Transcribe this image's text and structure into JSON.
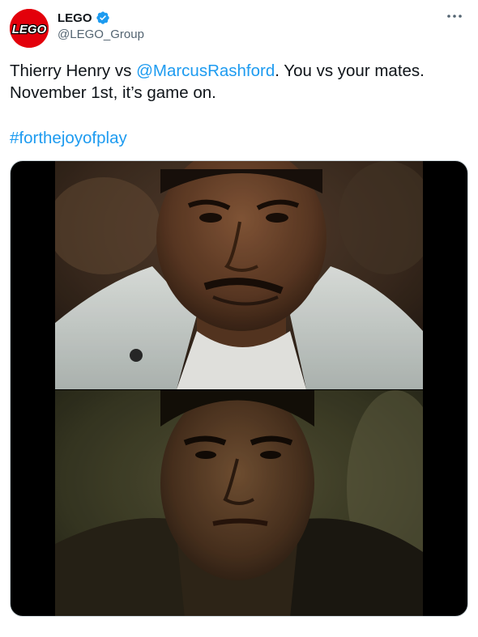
{
  "author": {
    "display_name": "LEGO",
    "handle": "@LEGO_Group",
    "avatar_text": "LEGO",
    "verified": true,
    "brand_color": "#e3000b"
  },
  "menu": {
    "more_icon": "more-horizontal-icon",
    "more_glyph": "···"
  },
  "tweet": {
    "text_part1": "Thierry Henry vs ",
    "mention": "@MarcusRashford",
    "text_part2": ". You vs your mates. November 1st, it’s game on.",
    "hashtag": "#forthejoyofplay",
    "link_color": "#1d9bf0"
  },
  "media": {
    "type": "video",
    "frames": [
      "top-frame",
      "bottom-frame"
    ]
  }
}
